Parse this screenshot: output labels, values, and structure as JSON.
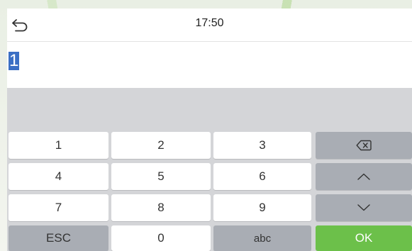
{
  "header": {
    "time": "17:50",
    "back_icon": "back-arrow-icon"
  },
  "input": {
    "value": "1"
  },
  "keyboard": {
    "rows": [
      [
        "1",
        "2",
        "3",
        "backspace"
      ],
      [
        "4",
        "5",
        "6",
        "up"
      ],
      [
        "7",
        "8",
        "9",
        "down"
      ],
      [
        "ESC",
        "0",
        "abc",
        "OK"
      ]
    ],
    "digits": {
      "k1": "1",
      "k2": "2",
      "k3": "3",
      "k4": "4",
      "k5": "5",
      "k6": "6",
      "k7": "7",
      "k8": "8",
      "k9": "9",
      "k0": "0"
    },
    "esc_label": "ESC",
    "abc_label": "abc",
    "ok_label": "OK",
    "icons": {
      "backspace": "backspace-icon",
      "up": "chevron-up-icon",
      "down": "chevron-down-icon"
    },
    "colors": {
      "keyboard_bg": "#d4d5d8",
      "function_key": "#a9adb4",
      "ok_key": "#6cc04a",
      "selection": "#3b6fc4"
    }
  }
}
